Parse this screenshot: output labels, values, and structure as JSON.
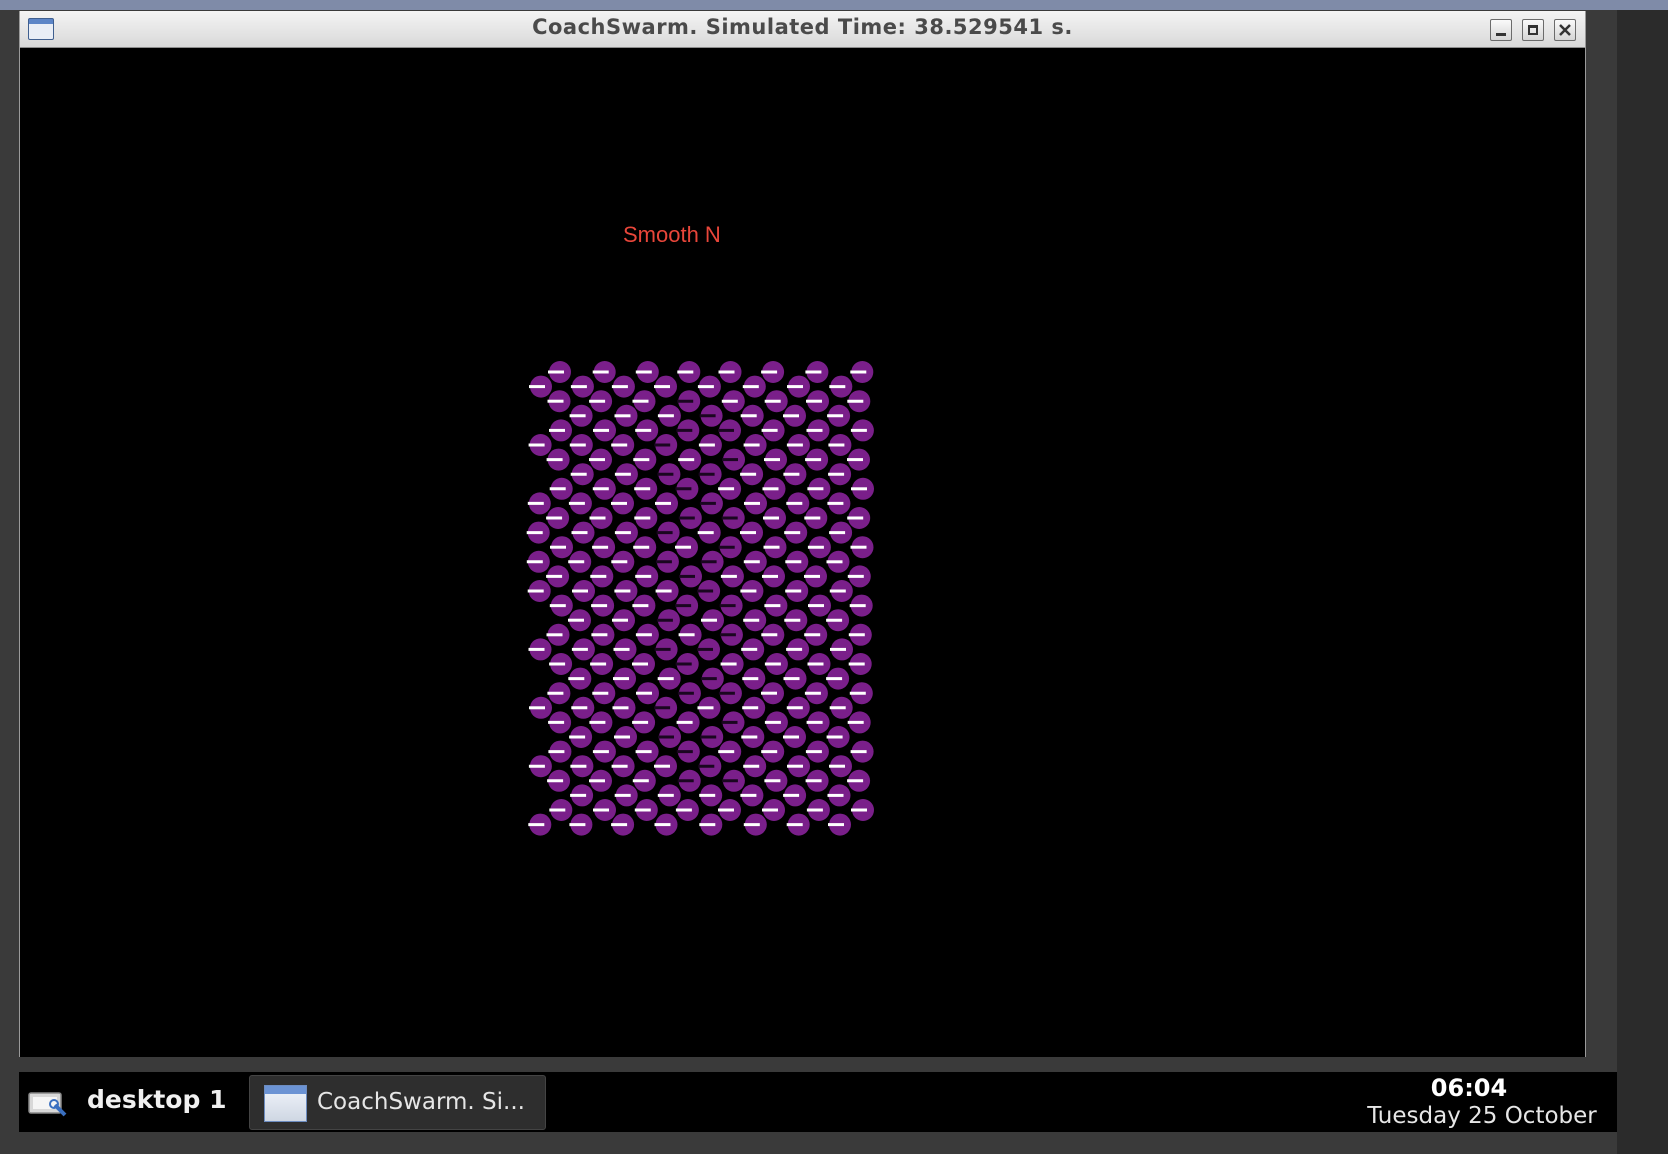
{
  "window": {
    "title": "CoachSwarm. Simulated Time: 38.529541 s.",
    "icon": "window-app-icon",
    "buttons": [
      "minimize-icon",
      "maximize-icon",
      "close-icon"
    ]
  },
  "canvas": {
    "background": "#000000",
    "overlay_label": "Smooth N",
    "overlay_color": "#e8463a",
    "swarm": {
      "agent_color": "#7a1f8a",
      "heading_color": "#ffffff",
      "columns": 8,
      "rows": 32,
      "heading_direction": "west"
    }
  },
  "taskbar": {
    "desktop_label": "desktop 1",
    "task_label": "CoachSwarm. Si...",
    "clock_time": "06:04",
    "clock_date": "Tuesday 25 October"
  }
}
